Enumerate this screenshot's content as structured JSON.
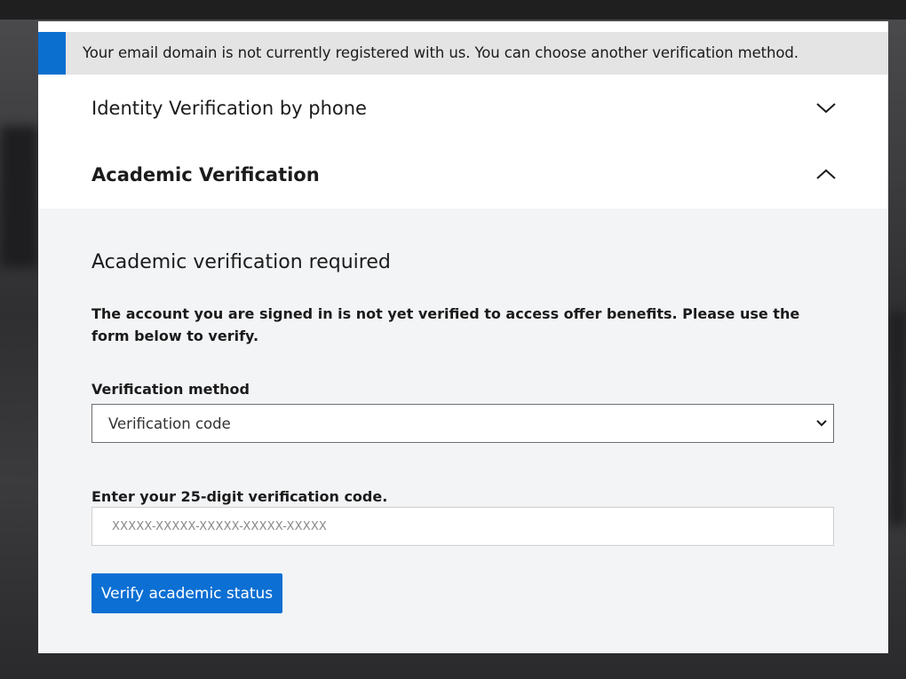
{
  "banner": {
    "message": "Your email domain is not currently registered with us. You can choose another verification method."
  },
  "accordion": [
    {
      "title": "Identity Verification by phone",
      "expanded": false
    },
    {
      "title": "Academic Verification",
      "expanded": true
    }
  ],
  "academic": {
    "heading": "Academic verification required",
    "description": "The account you are signed in is not yet verified to access offer benefits. Please use the form below to verify.",
    "method_label": "Verification method",
    "method_value": "Verification code",
    "code_label": "Enter your 25-digit verification code.",
    "code_placeholder": "XXXXX-XXXXX-XXXXX-XXXXX-XXXXX",
    "code_value": "",
    "submit_label": "Verify academic status"
  },
  "colors": {
    "accent": "#0b6fd3",
    "banner_bg": "#e4e4e4",
    "content_bg": "#f3f4f6"
  }
}
